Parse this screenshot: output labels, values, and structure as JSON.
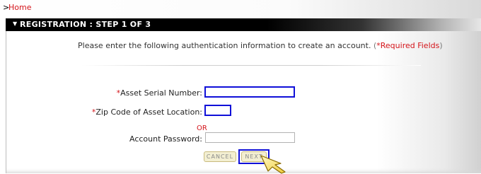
{
  "breadcrumb": {
    "arrow": ">",
    "home": "Home"
  },
  "header": {
    "title": "REGISTRATION : STEP 1 OF 3"
  },
  "intro": {
    "text": "Please enter the following authentication information to create an account.",
    "required_star": "*",
    "required_label": "Required Fields"
  },
  "form": {
    "serial_label": "Asset Serial Number:",
    "serial_value": "",
    "zip_label": "Zip Code of Asset Location:",
    "zip_value": "",
    "or_text": "OR",
    "password_label": "Account Password:",
    "password_value": "",
    "required_star": "*"
  },
  "buttons": {
    "cancel": "CANCEL",
    "next": "NEXT"
  },
  "colors": {
    "accent_red": "#d4141a",
    "highlight_blue": "#1010d8",
    "button_bg": "#f3efd2"
  },
  "icons": {
    "pointer": "cursor-arrow-icon",
    "collapse": "caret-down-icon"
  }
}
